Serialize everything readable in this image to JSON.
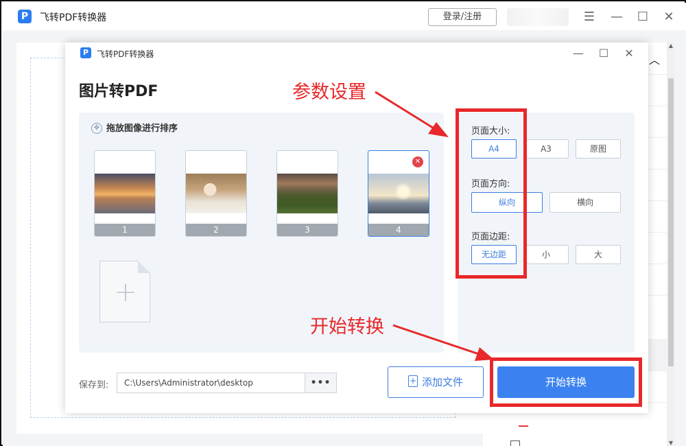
{
  "app": {
    "title": "飞转PDF转换器",
    "logo_letter": "P",
    "login_label": "登录/注册"
  },
  "dialog": {
    "title": "飞转PDF转换器",
    "heading": "图片转PDF",
    "sort_hint": "拖放图像进行排序",
    "thumbnails": [
      "1",
      "2",
      "3",
      "4"
    ],
    "selected_thumbnail": "4"
  },
  "settings": {
    "page_size": {
      "label": "页面大小:",
      "options": [
        "A4",
        "A3",
        "原图"
      ],
      "selected": "A4"
    },
    "orientation": {
      "label": "页面方向:",
      "options": [
        "纵向",
        "横向"
      ],
      "selected": "纵向"
    },
    "margin": {
      "label": "页面边距:",
      "options": [
        "无边距",
        "小",
        "大"
      ],
      "selected": "无边距"
    }
  },
  "footer": {
    "save_label": "保存到:",
    "save_path": "C:\\Users\\Administrator\\desktop",
    "browse_label": "•••",
    "add_file_label": "添加文件",
    "start_label": "开始转换"
  },
  "annotations": {
    "settings_callout": "参数设置",
    "start_callout": "开始转换",
    "color": "#e8282a"
  },
  "colors": {
    "accent": "#3b82f0",
    "delete": "#e3434a"
  },
  "icons": {
    "minimize": "minimize-icon",
    "maximize": "maximize-icon",
    "close": "close-icon",
    "menu": "menu-icon",
    "move": "move-icon",
    "add_page": "plus-icon",
    "add_file": "file-plus-icon"
  }
}
